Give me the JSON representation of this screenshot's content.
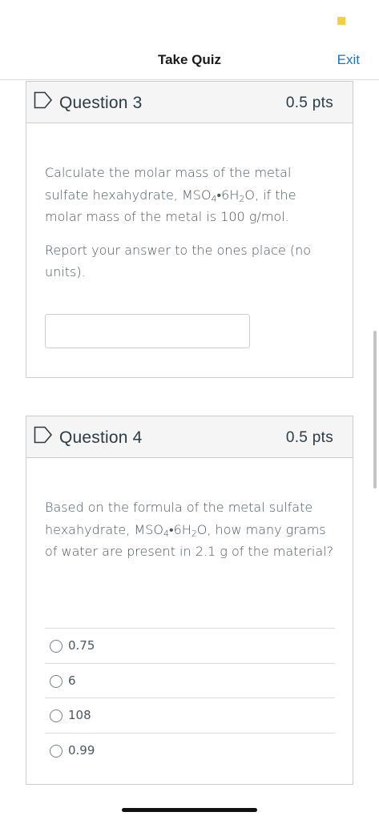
{
  "header": {
    "title": "Take Quiz",
    "exit_label": "Exit"
  },
  "questions": [
    {
      "title": "Question 3",
      "points": "0.5 pts",
      "text_part1": "Calculate the molar mass of the metal sulfate hexahydrate, MSO",
      "sub1": "4",
      "text_part2": "•6H",
      "sub2": "2",
      "text_part3": "O, if the molar mass of the metal is 100 g/mol.",
      "instruction": "Report your answer to the ones place (no units).",
      "answer_value": ""
    },
    {
      "title": "Question 4",
      "points": "0.5 pts",
      "text_part1": "Based on the formula of the metal sulfate hexahydrate, MSO",
      "sub1": "4",
      "text_part2": "•6H",
      "sub2": "2",
      "text_part3": "O, how many grams of water are present in 2.1 g of the material?",
      "options": [
        "0.75",
        "6",
        "108",
        "0.99"
      ]
    }
  ],
  "colors": {
    "accent": "#1f73b7",
    "status_dot": "#f4d03f",
    "header_bg": "#f5f5f5",
    "border": "#c7cdd1"
  },
  "icons": {
    "flag": "bookmark-flag-icon"
  }
}
